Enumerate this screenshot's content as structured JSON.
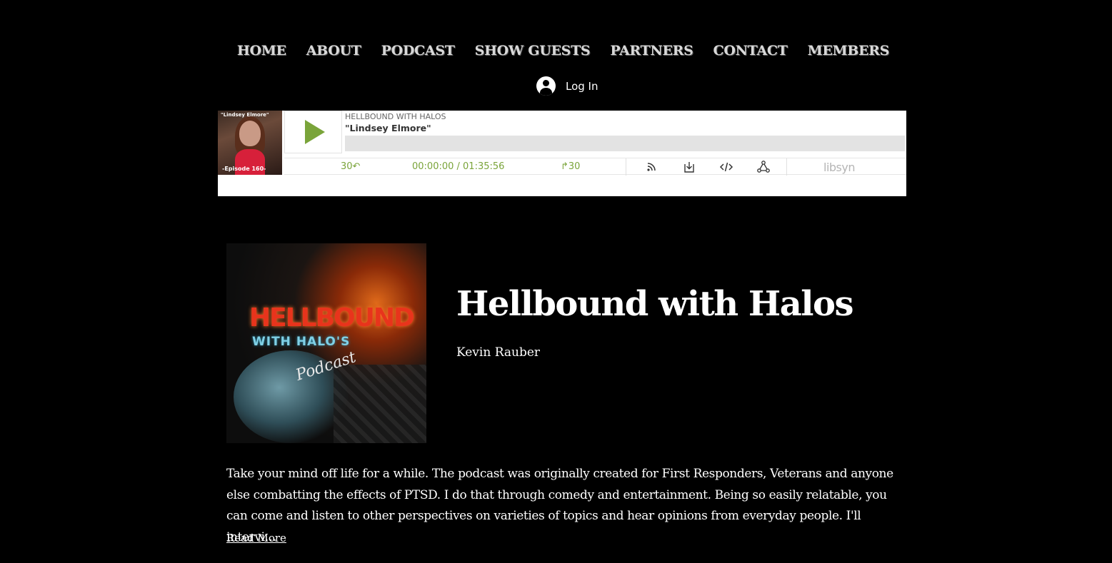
{
  "nav": {
    "items": [
      "HOME",
      "ABOUT",
      "PODCAST",
      "SHOW GUESTS",
      "PARTNERS",
      "CONTACT",
      "MEMBERS"
    ]
  },
  "login": {
    "label": "Log In"
  },
  "player": {
    "thumb_name": "\"Lindsey Elmore\"",
    "thumb_episode": "-Episode 160-",
    "show_name": "HELLBOUND WITH HALOS",
    "episode_title": "\"Lindsey Elmore\"",
    "progress": 0,
    "rewind_label": "30↶",
    "time": "00:00:00 / 01:35:56",
    "forward_label": "↱30",
    "brand": "libsyn",
    "accent_color": "#7aa43a",
    "icons": [
      "rss-icon",
      "download-icon",
      "embed-code-icon",
      "share-icon"
    ]
  },
  "cover": {
    "line1": "HELLBOUND",
    "line2": "WITH HALO'S",
    "line3": "Podcast"
  },
  "podcast": {
    "title": "Hellbound with Halos",
    "author": "Kevin Rauber",
    "description": "Take your mind off life for a while. The podcast was originally created for First Responders, Veterans and anyone\nelse combatting the effects of PTSD. I do that through comedy and entertainment. Being so easily relatable, you\ncan come and listen to other perspectives on varieties of topics and hear opinions from everyday people. I'll intervi…",
    "read_more": "Read More"
  }
}
